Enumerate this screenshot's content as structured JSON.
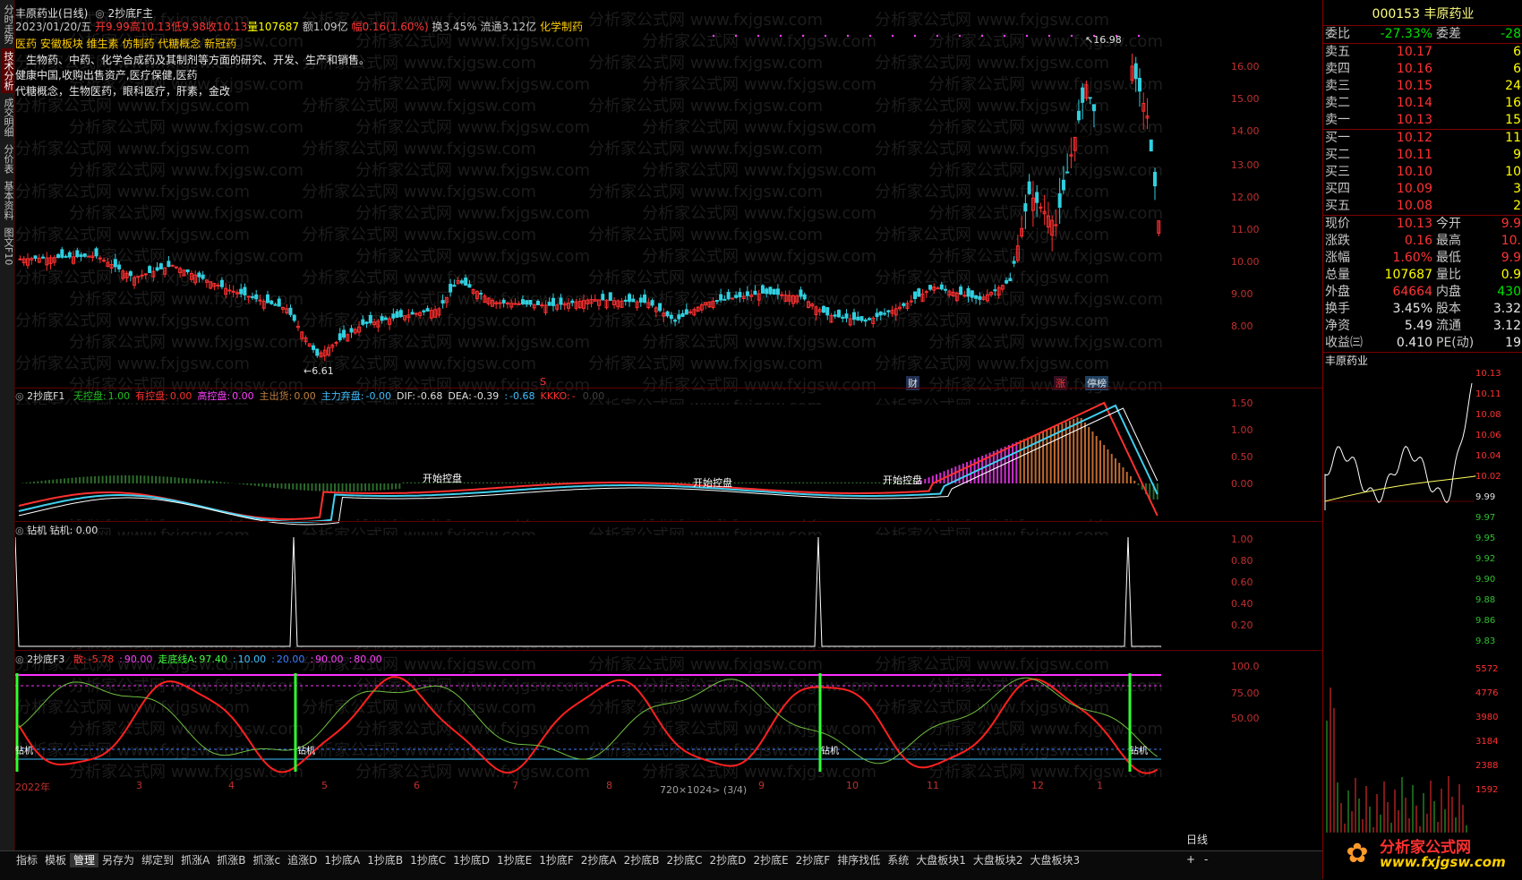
{
  "left_tabs": [
    "分时走势",
    "技术分析",
    "成交明细",
    "分价表",
    "基本资料",
    "图文F10"
  ],
  "header": {
    "title": "丰原药业(日线)",
    "formula": "2抄底F主",
    "date": "2023/01/20/五",
    "open": "开9.99",
    "high": "高10.13",
    "low": "低9.98",
    "close": "收10.13",
    "volume": "量107687",
    "amount": "额1.09亿",
    "change": "幅0.16(1.60%)",
    "turnover": "换3.45%",
    "float": "流通3.12亿",
    "industry": "化学制药",
    "concepts_line": "医药 安徽板块 维生素 仿制药 代糖概念 新冠药",
    "desc_1": "生物药、中药、化学合成药及其制剂等方面的研究、开发、生产和销售。",
    "desc_2": "健康中国,收购出售资产,医疗保健,医药",
    "desc_3": "代糖概念，生物医药，眼科医疗，肝素，金改"
  },
  "main_chart": {
    "high_label": "16.98",
    "low_label": "6.61",
    "y_ticks": [
      "16.00",
      "15.00",
      "14.00",
      "13.00",
      "12.00",
      "11.00",
      "10.00",
      "9.00",
      "8.00"
    ],
    "markers": [
      "S",
      "财",
      "涨",
      "停榜"
    ]
  },
  "f1": {
    "name": "2抄底F1",
    "items": [
      {
        "label": "无控盘:",
        "value": "1.00",
        "color": "#20c020"
      },
      {
        "label": "有控盘:",
        "value": "0.00",
        "color": "#ff3030"
      },
      {
        "label": "高控盘:",
        "value": "0.00",
        "color": "#ff40ff"
      },
      {
        "label": "主出货:",
        "value": "0.00",
        "color": "#c08040"
      },
      {
        "label": "主力弃盘:",
        "value": "-0.00",
        "color": "#40c0ff"
      },
      {
        "label": "DIF:",
        "value": "-0.68",
        "color": "#e0e0e0"
      },
      {
        "label": "DEA:",
        "value": "-0.39",
        "color": "#e0e0e0"
      },
      {
        "label": ":",
        "value": "-0.68",
        "color": "#40c0ff"
      },
      {
        "label": "KKKO:",
        "value": "-",
        "color": "#ff3030"
      },
      {
        "label": "",
        "value": "0.00",
        "color": "#404040"
      }
    ],
    "annot": [
      "开始控盘",
      "开始控盘",
      "开始控盘"
    ],
    "y_ticks": [
      "1.50",
      "1.00",
      "0.50",
      "0.00"
    ]
  },
  "f2": {
    "name": "钻机",
    "line": "钻机: 0.00",
    "y_ticks": [
      "1.00",
      "0.80",
      "0.60",
      "0.40",
      "0.20"
    ]
  },
  "f3": {
    "name": "2抄底F3",
    "items": [
      {
        "label": "散:",
        "value": "-5.78",
        "color": "#ff3030"
      },
      {
        "label": ":",
        "value": "90.00",
        "color": "#ff40ff"
      },
      {
        "label": "走底线A:",
        "value": "97.40",
        "color": "#40ff40"
      },
      {
        "label": ":",
        "value": "10.00",
        "color": "#40c0ff"
      },
      {
        "label": ":",
        "value": "20.00",
        "color": "#4080ff"
      },
      {
        "label": ":",
        "value": "90.00",
        "color": "#ff40ff"
      },
      {
        "label": ":",
        "value": "80.00",
        "color": "#ff40ff"
      }
    ],
    "zuanji": "钻机",
    "y_ticks": [
      "100.0",
      "75.00",
      "50.00"
    ]
  },
  "x_axis": [
    "2022年",
    "3",
    "4",
    "5",
    "6",
    "7",
    "8",
    "9",
    "10",
    "11",
    "12",
    "1"
  ],
  "status": {
    "resolution": "720×1024> (3/4)"
  },
  "bottom_tabs": [
    "指标",
    "模板",
    "管理",
    "另存为",
    "绑定到",
    "抓涨A",
    "抓涨B",
    "抓涨c",
    "追涨D",
    "1抄底A",
    "1抄底B",
    "1抄底C",
    "1抄底D",
    "1抄底E",
    "1抄底F",
    "2抄底A",
    "2抄底B",
    "2抄底C",
    "2抄底D",
    "2抄底E",
    "2抄底F",
    "排序找低",
    "系统",
    "大盘板块1",
    "大盘板块2",
    "大盘板块3"
  ],
  "bottom_right": {
    "period": "日线",
    "plus": "+",
    "minus": "-"
  },
  "quote": {
    "code": "000153",
    "name": "丰原药业",
    "weibi_label": "委比",
    "weibi": "-27.33%",
    "weicha_label": "委差",
    "weicha": "-28",
    "asks": [
      {
        "label": "卖五",
        "price": "10.17",
        "vol": "6"
      },
      {
        "label": "卖四",
        "price": "10.16",
        "vol": "6"
      },
      {
        "label": "卖三",
        "price": "10.15",
        "vol": "24"
      },
      {
        "label": "卖二",
        "price": "10.14",
        "vol": "16"
      },
      {
        "label": "卖一",
        "price": "10.13",
        "vol": "15"
      }
    ],
    "bids": [
      {
        "label": "买一",
        "price": "10.12",
        "vol": "11"
      },
      {
        "label": "买二",
        "price": "10.11",
        "vol": "9"
      },
      {
        "label": "买三",
        "price": "10.10",
        "vol": "10"
      },
      {
        "label": "买四",
        "price": "10.09",
        "vol": "3"
      },
      {
        "label": "买五",
        "price": "10.08",
        "vol": "2"
      }
    ],
    "stats": [
      {
        "l": "现价",
        "v": "10.13",
        "vc": "red",
        "l2": "今开",
        "v2": "9.9",
        "v2c": "red"
      },
      {
        "l": "涨跌",
        "v": "0.16",
        "vc": "red",
        "l2": "最高",
        "v2": "10.",
        "v2c": "red"
      },
      {
        "l": "涨幅",
        "v": "1.60%",
        "vc": "red",
        "l2": "最低",
        "v2": "9.9",
        "v2c": "red"
      },
      {
        "l": "总量",
        "v": "107687",
        "vc": "yel",
        "l2": "量比",
        "v2": "0.9",
        "v2c": "yel"
      },
      {
        "l": "外盘",
        "v": "64664",
        "vc": "red",
        "l2": "内盘",
        "v2": "430",
        "v2c": "green"
      },
      {
        "l": "换手",
        "v": "3.45%",
        "vc": "wht",
        "l2": "股本",
        "v2": "3.32",
        "v2c": "wht"
      },
      {
        "l": "净资",
        "v": "5.49",
        "vc": "wht",
        "l2": "流通",
        "v2": "3.12",
        "v2c": "wht"
      },
      {
        "l": "收益㈢",
        "v": "0.410",
        "vc": "wht",
        "l2": "PE(动)",
        "v2": "19",
        "v2c": "wht"
      }
    ],
    "mini_title": "丰原药业",
    "mini_price_ticks": [
      "10.13",
      "10.11",
      "10.08",
      "10.06",
      "10.04",
      "10.02",
      "9.99",
      "9.97",
      "9.95",
      "9.92",
      "9.90",
      "9.88",
      "9.86",
      "9.83"
    ],
    "mini_vol_ticks": [
      "5572",
      "4776",
      "3980",
      "3184",
      "2388",
      "1592"
    ]
  },
  "watermark": "分析家公式网 www.fxjgsw.com",
  "logo": {
    "line1": "分析家公式网",
    "line2": "www.fxjgsw.com"
  }
}
